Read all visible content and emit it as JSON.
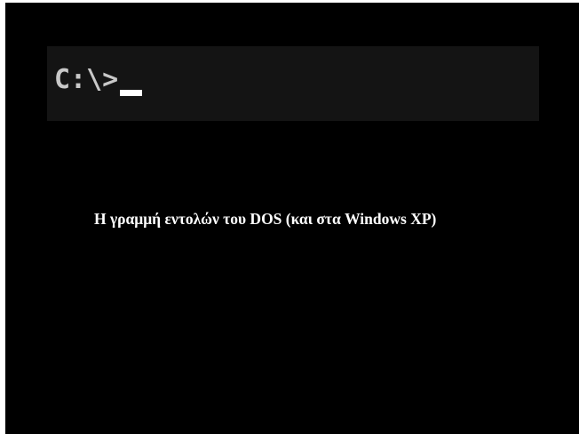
{
  "terminal": {
    "prompt": "C:\\>",
    "cursor": "_",
    "colors": {
      "background": "#000000",
      "panel": "#141414",
      "prompt_text": "#c8c8c8",
      "cursor": "#ffffff"
    }
  },
  "caption": {
    "text": "Η γραμμή εντολών του DOS (και στα Windows XP)",
    "color": "#ffffff"
  }
}
